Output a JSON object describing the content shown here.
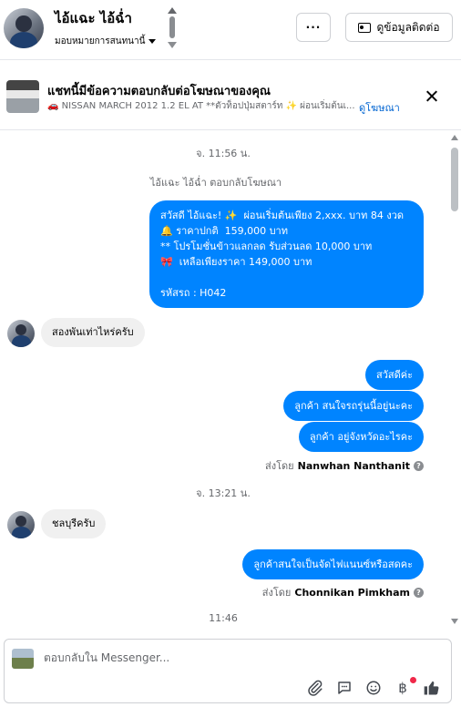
{
  "header": {
    "contact_name": "ไอ้แฉะ ไอ้ฉ่ำ",
    "assign_label": "มอบหมายการสนทนานี้",
    "more_label": "···",
    "contact_info_label": "ดูข้อมูลติดต่อ"
  },
  "ad_banner": {
    "title": "แชทนี้มีข้อความตอบกลับต่อโฆษณาของคุณ",
    "subtitle": "NISSAN MARCH 2012 1.2 EL AT **ตัวท็อปปุ่มสตาร์ท ✨ ผ่อนเริ่มต้นเ...",
    "view_ad_label": "ดูโฆษณา"
  },
  "thread": {
    "time_1": "จ. 11:56 น.",
    "system_note": "ไอ้แฉะ ไอ้ฉ่ำ ตอบกลับโฆษณา",
    "ad_reply_message": "สวัสดี ไอ้แฉะ! ✨  ผ่อนเริ่มต้นเพียง 2,xxx. บาท 84 งวด\n🔔 ราคาปกติ  159,000 บาท\n** โปรโมชั่นข้าวแลกลด รับส่วนลด 10,000 บาท\n🎀  เหลือเพียงราคา 149,000 บาท\n\nรหัสรถ : H042",
    "in_msg_1": "สองพันเท่าไหร่ครับ",
    "out_msg_1": "สวัสดีค่ะ",
    "out_msg_2": "ลูกค้า สนใจรถรุ่นนี้อยู่นะคะ",
    "out_msg_3": "ลูกค้า อยู่จังหวัดอะไรคะ",
    "sent_by_label_1": "ส่งโดย",
    "sent_by_name_1": "Nanwhan Nanthanit",
    "time_2": "จ. 13:21 น.",
    "in_msg_2": "ชลบุรีครับ",
    "out_msg_4": "ลูกค้าสนใจเป็นจัดไฟแนนซ์หรือสดคะ",
    "sent_by_label_2": "ส่งโดย",
    "sent_by_name_2": "Chonnikan Pimkham",
    "time_3": "11:46"
  },
  "composer": {
    "placeholder": "ตอบกลับใน Messenger..."
  },
  "icons": [
    "nav-up-icon",
    "nav-down-icon",
    "card-icon",
    "close-icon",
    "attach-icon",
    "saved-replies-icon",
    "emoji-icon",
    "payment-icon",
    "like-icon"
  ],
  "colors": {
    "outgoing_bubble": "#0084ff",
    "incoming_bubble": "#f0f0f0",
    "link": "#0064d1",
    "like": "#1877f2"
  }
}
